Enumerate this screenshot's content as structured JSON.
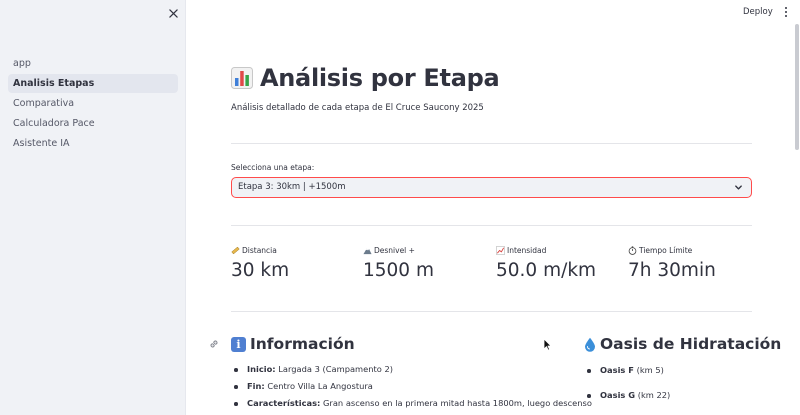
{
  "sidebar": {
    "items": [
      {
        "label": "app",
        "active": false
      },
      {
        "label": "Analisis Etapas",
        "active": true
      },
      {
        "label": "Comparativa",
        "active": false
      },
      {
        "label": "Calculadora Pace",
        "active": false
      },
      {
        "label": "Asistente IA",
        "active": false
      }
    ],
    "close_icon": "close-icon"
  },
  "header": {
    "deploy_label": "Deploy",
    "menu_icon": "kebab-menu-icon"
  },
  "main": {
    "title_icon": "bar-chart-emoji-icon",
    "title": "Análisis por Etapa",
    "subtitle": "Análisis detallado de cada etapa de El Cruce Saucony 2025",
    "select": {
      "label": "Selecciona una etapa:",
      "value": "Etapa 3: 30km | +1500m"
    },
    "metrics": [
      {
        "icon": "ruler-icon",
        "label": "Distancia",
        "value": "30 km"
      },
      {
        "icon": "mountain-icon",
        "label": "Desnivel +",
        "value": "1500 m"
      },
      {
        "icon": "chart-up-icon",
        "label": "Intensidad",
        "value": "50.0 m/km"
      },
      {
        "icon": "stopwatch-icon",
        "label": "Tiempo Límite",
        "value": "7h 30min"
      }
    ],
    "info": {
      "icon": "info-icon",
      "title": "Información",
      "items": [
        {
          "label": "Inicio:",
          "text": "Largada 3 (Campamento 2)"
        },
        {
          "label": "Fin:",
          "text": "Centro Villa La Angostura"
        },
        {
          "label": "Características:",
          "text": "Gran ascenso en la primera mitad hasta 1800m, luego descenso"
        }
      ]
    },
    "oasis": {
      "icon": "droplet-icon",
      "title": "Oasis de Hidratación",
      "items": [
        {
          "label": "Oasis F",
          "text": "(km 5)"
        },
        {
          "label": "Oasis G",
          "text": "(km 22)"
        }
      ]
    }
  },
  "colors": {
    "accent": "#ff4b4b",
    "sidebar_bg": "#f0f2f6",
    "text": "#31333f",
    "info_badge": "#4f7fd1",
    "droplet": "#3b8fd9"
  }
}
